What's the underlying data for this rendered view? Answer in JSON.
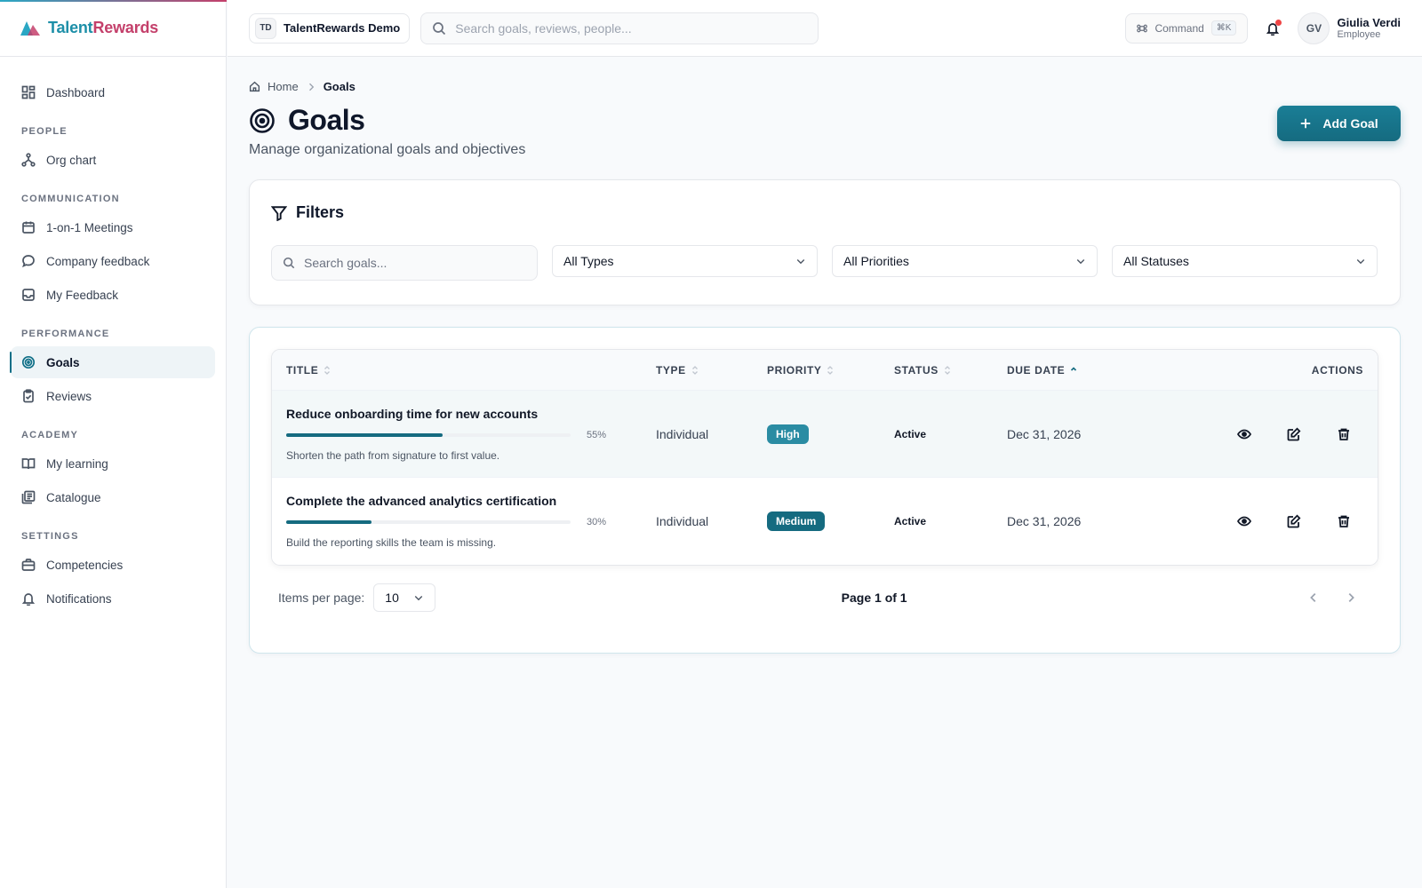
{
  "brand": {
    "part1": "Talent",
    "part2": "Rewards"
  },
  "header": {
    "org_initials": "TD",
    "org_name": "TalentRewards Demo",
    "search_placeholder": "Search goals, reviews, people...",
    "command_label": "Command",
    "command_shortcut": "⌘K",
    "user": {
      "initials": "GV",
      "name": "Giulia Verdi",
      "role": "Employee"
    }
  },
  "sidebar": {
    "dashboard": "Dashboard",
    "sections": {
      "people": "PEOPLE",
      "communication": "COMMUNICATION",
      "performance": "PERFORMANCE",
      "academy": "ACADEMY",
      "settings": "SETTINGS"
    },
    "items": {
      "org_chart": "Org chart",
      "meetings": "1-on-1 Meetings",
      "company_feedback": "Company feedback",
      "my_feedback": "My Feedback",
      "goals": "Goals",
      "reviews": "Reviews",
      "my_learning": "My learning",
      "catalogue": "Catalogue",
      "competencies": "Competencies",
      "notifications": "Notifications"
    },
    "active": "Goals"
  },
  "breadcrumb": {
    "home": "Home",
    "current": "Goals"
  },
  "page": {
    "title": "Goals",
    "subtitle": "Manage organizational goals and objectives",
    "add_button": "Add Goal"
  },
  "filters": {
    "title": "Filters",
    "search_placeholder": "Search goals...",
    "type": "All Types",
    "priority": "All Priorities",
    "status": "All Statuses"
  },
  "table": {
    "headers": {
      "title": "TITLE",
      "type": "TYPE",
      "priority": "PRIORITY",
      "status": "STATUS",
      "due_date": "DUE DATE",
      "actions": "ACTIONS"
    },
    "rows": [
      {
        "title": "Reduce onboarding time for new accounts",
        "progress": 55,
        "progress_label": "55%",
        "description": "Shorten the path from signature to first value.",
        "type": "Individual",
        "priority": "High",
        "priority_color": "#2a8ca3",
        "status": "Active",
        "due_date": "Dec 31, 2026"
      },
      {
        "title": "Complete the advanced analytics certification",
        "progress": 30,
        "progress_label": "30%",
        "description": "Build the reporting skills the team is missing.",
        "type": "Individual",
        "priority": "Medium",
        "priority_color": "#156b80",
        "status": "Active",
        "due_date": "Dec 31, 2026"
      }
    ]
  },
  "pagination": {
    "per_page_label": "Items per page:",
    "per_page_value": "10",
    "page_info": "Page 1 of 1"
  },
  "colors": {
    "accent": "#156b80",
    "brand_teal": "#1d8fa8",
    "brand_pink": "#c4406b"
  }
}
